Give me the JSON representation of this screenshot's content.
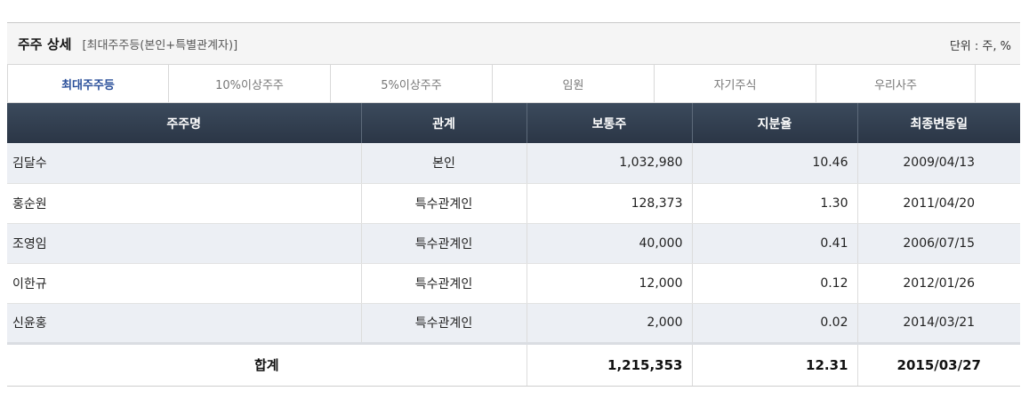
{
  "header": {
    "title": "주주 상세",
    "subtitle": "[최대주주등(본인+특별관계자)]",
    "unit": "단위 : 주, %"
  },
  "tabs": [
    {
      "label": "최대주주등",
      "active": true
    },
    {
      "label": "10%이상주주",
      "active": false
    },
    {
      "label": "5%이상주주",
      "active": false
    },
    {
      "label": "임원",
      "active": false
    },
    {
      "label": "자기주식",
      "active": false
    },
    {
      "label": "우리사주",
      "active": false
    }
  ],
  "table": {
    "columns": [
      "주주명",
      "관계",
      "보통주",
      "지분율",
      "최종변동일"
    ],
    "rows": [
      {
        "name": "김달수",
        "relation": "본인",
        "shares": "1,032,980",
        "ratio": "10.46",
        "date": "2009/04/13"
      },
      {
        "name": "홍순원",
        "relation": "특수관계인",
        "shares": "128,373",
        "ratio": "1.30",
        "date": "2011/04/20"
      },
      {
        "name": "조영임",
        "relation": "특수관계인",
        "shares": "40,000",
        "ratio": "0.41",
        "date": "2006/07/15"
      },
      {
        "name": "이한규",
        "relation": "특수관계인",
        "shares": "12,000",
        "ratio": "0.12",
        "date": "2012/01/26"
      },
      {
        "name": "신윤홍",
        "relation": "특수관계인",
        "shares": "2,000",
        "ratio": "0.02",
        "date": "2014/03/21"
      }
    ],
    "total": {
      "label": "합계",
      "shares": "1,215,353",
      "ratio": "12.31",
      "date": "2015/03/27"
    }
  },
  "colors": {
    "header_bg": "#2f3b4c",
    "active_tab": "#2a4f9a",
    "row_shade": "#eceff4"
  }
}
